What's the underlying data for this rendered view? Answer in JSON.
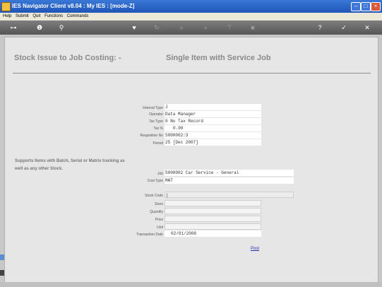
{
  "window": {
    "title": "IES Navigator Client v8.04 : My IES :      [mode-Z]"
  },
  "menu": [
    "Help",
    "Submit",
    "Quit",
    "Functions",
    "Commands"
  ],
  "toolbar_icons": [
    "key-icon",
    "info-icon",
    "search-icon",
    "heart-icon",
    "refresh-icon",
    "rewind-icon",
    "fast-forward-icon",
    "tree-icon",
    "stop-icon",
    "help-icon",
    "check-icon",
    "close-icon"
  ],
  "page": {
    "title_left": "Stock Issue to Job Costing: -",
    "title_right": "Single Item with Service Job"
  },
  "form": {
    "internal_type": {
      "label": "Internal Type",
      "value": "J"
    },
    "operator": {
      "label": "Operator",
      "value": "Data Manager"
    },
    "tax_type": {
      "label": "Tax Type",
      "value": "0 No Tax Record"
    },
    "tax_pct": {
      "label": "Tax %",
      "value": "0.00"
    },
    "requisition_no": {
      "label": "Requisition No",
      "value": "S000002:3"
    },
    "period": {
      "label": "Period",
      "value": "25  [Dec 2007]"
    },
    "job": {
      "label": "Job",
      "value": "S000002 Car Service - General"
    },
    "cost_type": {
      "label": "Cost Type",
      "value": "MAT"
    },
    "stock_code": {
      "label": "Stock Code",
      "value": "|"
    },
    "store": {
      "label": "Store",
      "value": ""
    },
    "quantity": {
      "label": "Quantity",
      "value": ""
    },
    "price": {
      "label": "Price",
      "value": ""
    },
    "unit": {
      "label": "Unit",
      "value": ""
    },
    "transaction_date": {
      "label": "Transaction Date",
      "value": "02/01/2008"
    }
  },
  "note": "Supports Items with Batch, Serial or Matrix tracking as well as any other Stock.",
  "post_label": "Post"
}
